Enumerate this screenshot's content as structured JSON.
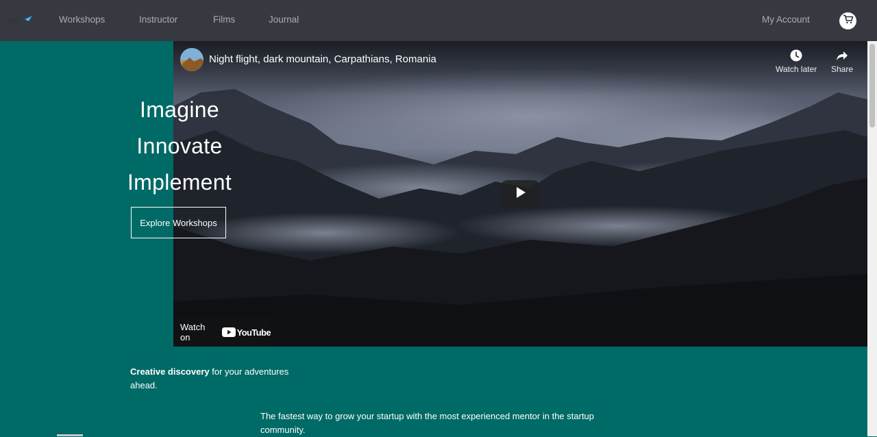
{
  "nav": {
    "logo_icon": "bird-logo-icon",
    "links": [
      "Workshops",
      "Instructor",
      "Films",
      "Journal"
    ],
    "account_label": "My Account",
    "cart_icon": "shopping-cart-icon"
  },
  "hero": {
    "lines": [
      "Imagine",
      "Innovate",
      "Implement"
    ],
    "cta_label": "Explore Workshops"
  },
  "video": {
    "title": "Night flight, dark mountain, Carpathians, Romania",
    "watch_later_label": "Watch later",
    "share_label": "Share",
    "watch_on_label": "Watch on",
    "youtube_label": "YouTube",
    "play_icon": "play-icon"
  },
  "content": {
    "tagline_bold": "Creative discovery",
    "tagline_rest": " for your adventures ahead.",
    "description": "The fastest way to grow your startup with the most experienced mentor in the startup community."
  },
  "colors": {
    "teal": "#006a66",
    "navbar": "#363a40",
    "nav_text": "#a9acb1"
  }
}
